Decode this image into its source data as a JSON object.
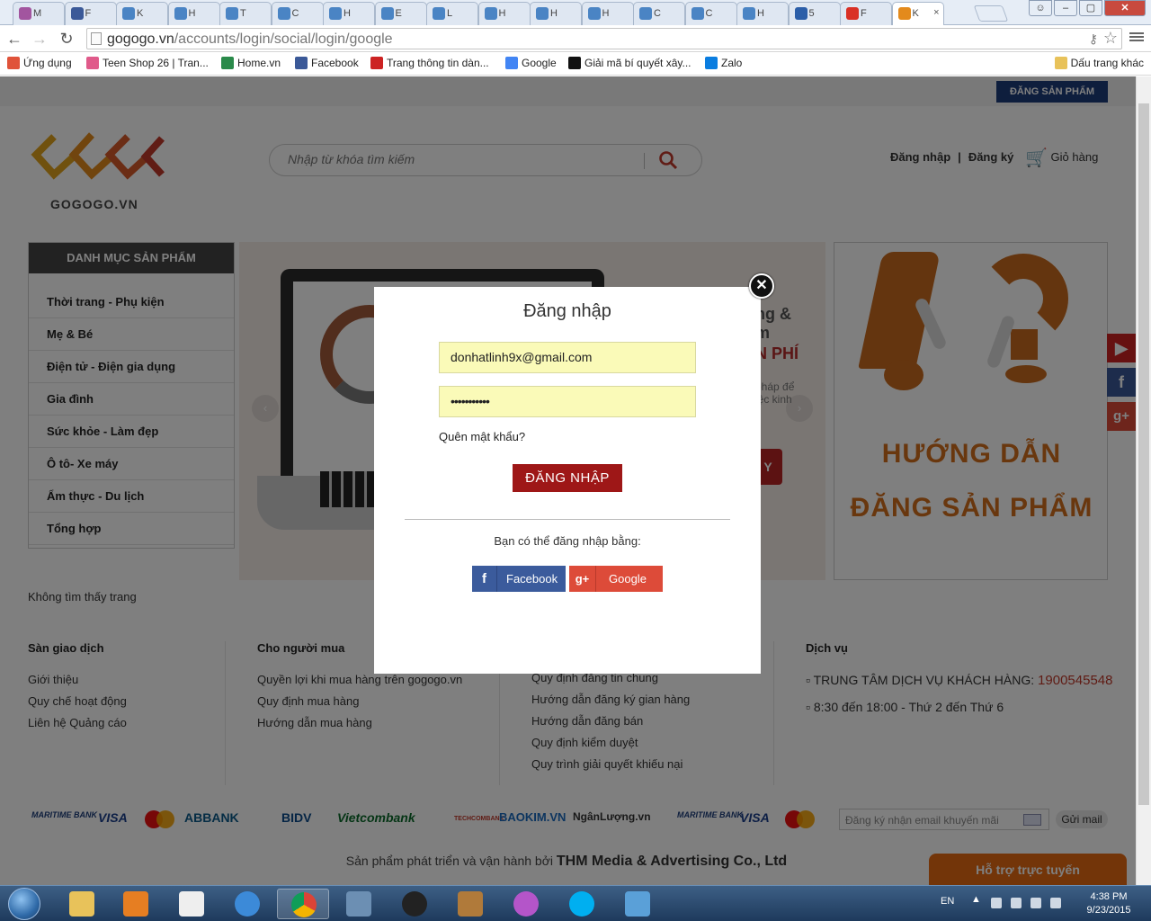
{
  "browser": {
    "tabs": [
      {
        "label": "M",
        "color": "#a2559f"
      },
      {
        "label": "F",
        "color": "#3b5998"
      },
      {
        "label": "K",
        "color": "#4a84c4"
      },
      {
        "label": "H",
        "color": "#4a84c4"
      },
      {
        "label": "T",
        "color": "#4a84c4"
      },
      {
        "label": "C",
        "color": "#4a84c4"
      },
      {
        "label": "H",
        "color": "#4a84c4"
      },
      {
        "label": "E",
        "color": "#4a84c4"
      },
      {
        "label": "L",
        "color": "#4a84c4"
      },
      {
        "label": "H",
        "color": "#4a84c4"
      },
      {
        "label": "H",
        "color": "#4a84c4"
      },
      {
        "label": "H",
        "color": "#4a84c4"
      },
      {
        "label": "C",
        "color": "#4a84c4"
      },
      {
        "label": "C",
        "color": "#4a84c4"
      },
      {
        "label": "H",
        "color": "#4a84c4"
      },
      {
        "label": "5",
        "color": "#2b5ea8"
      },
      {
        "label": "F",
        "color": "#d93025"
      },
      {
        "label": "K",
        "color": "#e38a1c"
      }
    ],
    "url_host": "gogogo.vn",
    "url_path": "/accounts/login/social/login/google",
    "bookmarks": [
      {
        "label": "Ứng dụng",
        "color": "#e0533a"
      },
      {
        "label": "Teen Shop 26 | Tran...",
        "color": "#e05a8a"
      },
      {
        "label": "Home.vn",
        "color": "#2a8a4a"
      },
      {
        "label": "Facebook",
        "color": "#3b5998"
      },
      {
        "label": "Trang thông tin dàn...",
        "color": "#cc2222"
      },
      {
        "label": "Google",
        "color": "#4285f4"
      },
      {
        "label": "Giải mã bí quyết xây...",
        "color": "#111111"
      },
      {
        "label": "Zalo",
        "color": "#0a7de0"
      }
    ],
    "bookmarks_other": "Dấu trang khác"
  },
  "site": {
    "post_button": "ĐĂNG SẢN PHẨM",
    "logo_text": "GOGOGO.VN",
    "search_placeholder": "Nhập từ khóa tìm kiếm",
    "login_link": "Đăng nhập",
    "register_link": "Đăng ký",
    "cart_label": "Giỏ hàng",
    "category_title": "DANH MỤC SẢN PHẨM",
    "categories": [
      "Thời trang - Phụ kiện",
      "Mẹ & Bé",
      "Điện tử - Điện gia dụng",
      "Gia đình",
      "Sức khỏe - Làm đẹp",
      "Ô tô- Xe máy",
      "Ẩm thực - Du lịch",
      "Tổng hợp"
    ],
    "not_found": "Không tìm thấy trang",
    "banner_text_1": "ng &",
    "banner_text_1b": "m",
    "banner_text_2": "N PHÍ",
    "banner_text_3": "pháp để",
    "banner_text_3b": "iệc kinh",
    "banner_btn": "Y",
    "guide_line_1": "HƯỚNG DẪN",
    "guide_line_2": "ĐĂNG SẢN PHẨM"
  },
  "footer": {
    "col1": {
      "title": "Sàn giao dịch",
      "links": [
        "Giới thiệu",
        "Quy chế hoạt động",
        "Liên hệ Quảng cáo"
      ]
    },
    "col2": {
      "title": "Cho người mua",
      "links": [
        "Quyền lợi khi mua hàng trên gogogo.vn",
        "Quy định mua hàng",
        "Hướng dẫn mua hàng"
      ]
    },
    "col3": {
      "links": [
        "Quy định đăng tin chung",
        "Hướng dẫn đăng ký gian hàng",
        "Hướng dẫn đăng bán",
        "Quy định kiểm duyệt",
        "Quy trình giải quyết khiếu nại"
      ]
    },
    "col4": {
      "title": "Dịch vụ",
      "hotline_label": "TRUNG TÂM DỊCH VỤ KHÁCH HÀNG:",
      "hotline": "1900545548",
      "hours": "8:30 đến 18:00 - Thứ 2 đến Thứ 6"
    },
    "banks": [
      "MARITIME BANK",
      "VISA",
      "ABBANK",
      "BIDV",
      "Vietcombank",
      "TECHCOMBANK",
      "BAOKIM.VN",
      "NgânLượng.vn",
      "MARITIME BANK",
      "VISA"
    ],
    "newsletter_placeholder": "Đăng ký nhận email khuyến mãi",
    "send_button": "Gửi mail",
    "credit_prefix": "Sản phẩm phát triển và vận hành bởi",
    "credit_company": "THM Media & Advertising Co., Ltd",
    "support_label": "Hỗ trợ trực tuyến"
  },
  "modal": {
    "title": "Đăng nhập",
    "email_value": "donhatlinh9x@gmail.com",
    "password_value": "•••••••••••",
    "forgot_label": "Quên mật khẩu?",
    "login_button": "ĐĂNG NHẬP",
    "alt_text": "Bạn có thể đăng nhập bằng:",
    "facebook_button": "Facebook",
    "google_button": "Google"
  },
  "taskbar": {
    "language": "EN",
    "time": "4:38 PM",
    "date": "9/23/2015"
  },
  "colors": {
    "accent_red": "#9e1717",
    "navy": "#1d3d7a",
    "orange": "#d26f1d",
    "facebook": "#3b5b9c",
    "google": "#dd4b39"
  }
}
